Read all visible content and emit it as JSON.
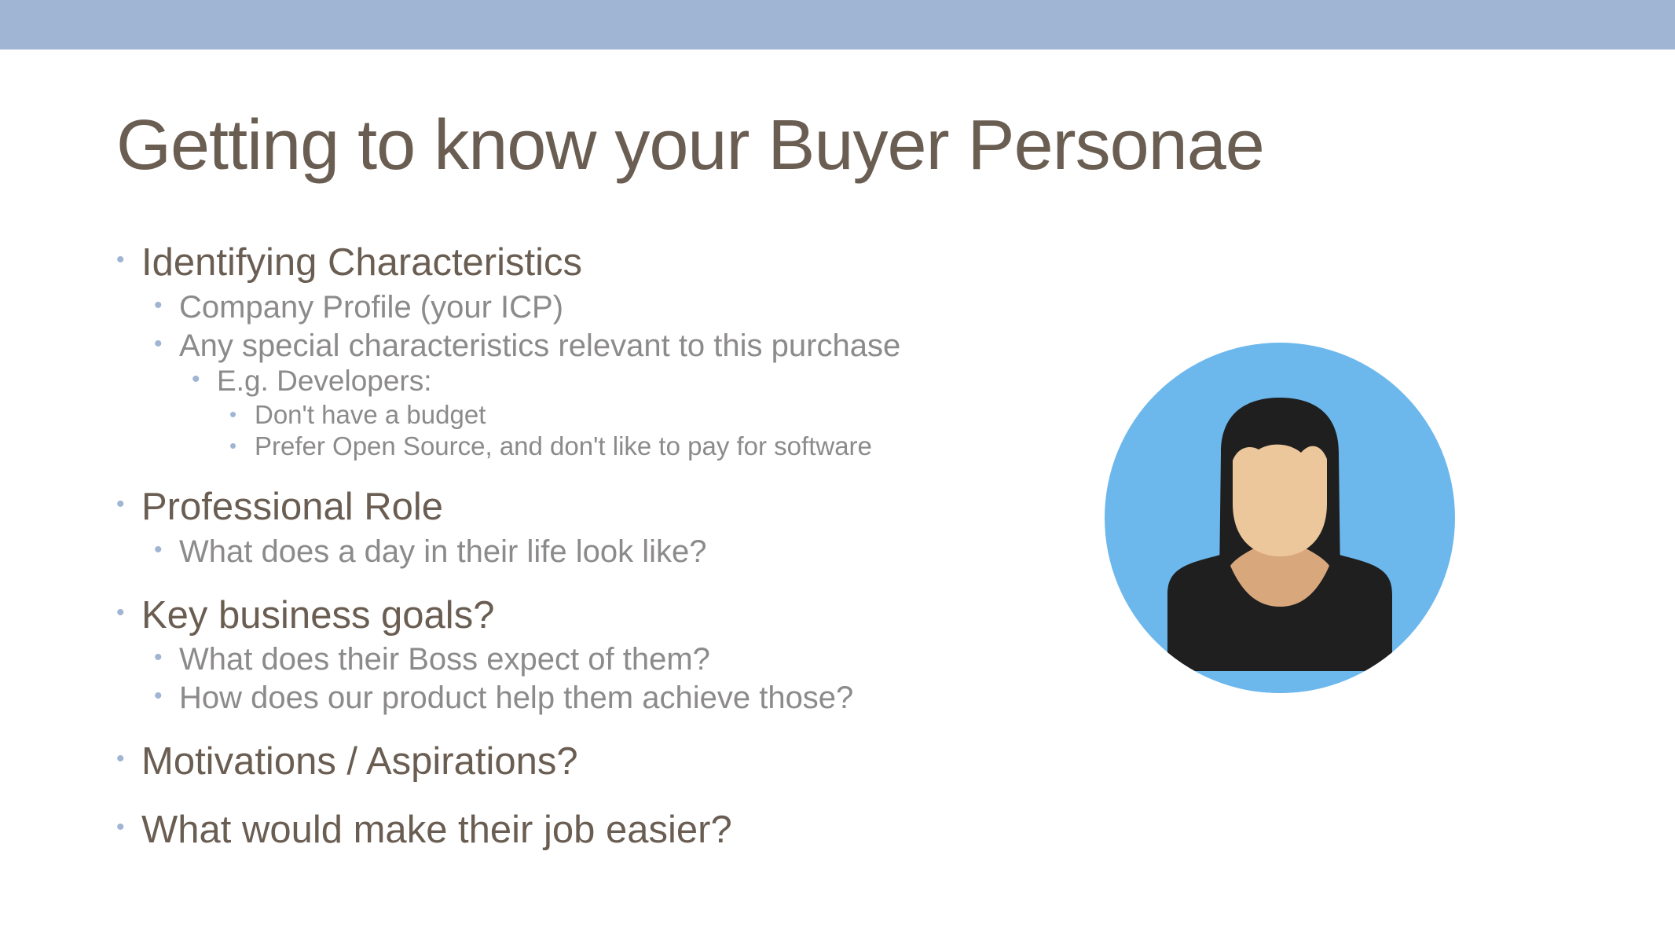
{
  "slide": {
    "title": "Getting to know your Buyer Personae",
    "bullets": [
      {
        "level": 1,
        "text": "Identifying Characteristics"
      },
      {
        "level": 2,
        "text": "Company Profile (your ICP)"
      },
      {
        "level": 2,
        "text": "Any special characteristics relevant to this purchase"
      },
      {
        "level": 3,
        "text": "E.g. Developers:"
      },
      {
        "level": 4,
        "text": "Don't have a budget"
      },
      {
        "level": 4,
        "text": "Prefer Open Source, and don't like to pay for software"
      },
      {
        "level": 1,
        "text": "Professional Role"
      },
      {
        "level": 2,
        "text": "What does a day in their life look like?"
      },
      {
        "level": 1,
        "text": "Key business goals?"
      },
      {
        "level": 2,
        "text": "What does their Boss expect of them?"
      },
      {
        "level": 2,
        "text": "How does our product help them achieve those?"
      },
      {
        "level": 1,
        "text": "Motivations / Aspirations?"
      },
      {
        "level": 1,
        "text": "What would make their job easier?"
      }
    ],
    "bullet_glyph": "•",
    "avatar_icon": "female-user-avatar-icon",
    "colors": {
      "header_band": "#9fb5d3",
      "title_text": "#6a5d52",
      "sub_text": "#8c8a8a",
      "avatar_background": "#6cb8ec",
      "avatar_hair": "#1f1f1f",
      "avatar_skin": "#ecc79b"
    }
  }
}
